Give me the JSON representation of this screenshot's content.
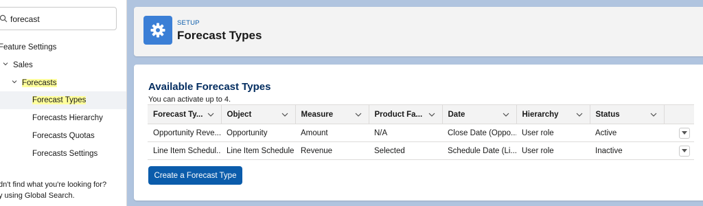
{
  "sidebar": {
    "search": {
      "value": "forecast"
    },
    "items": [
      {
        "label": "Feature Settings"
      },
      {
        "label": "Sales"
      },
      {
        "label": "Forecasts"
      },
      {
        "label": "Forecast Types"
      },
      {
        "label": "Forecasts Hierarchy"
      },
      {
        "label": "Forecasts Quotas"
      },
      {
        "label": "Forecasts Settings"
      }
    ],
    "help_line1": "dn't find what you're looking for?",
    "help_line2": "y using Global Search."
  },
  "header": {
    "eyebrow": "SETUP",
    "title": "Forecast Types",
    "icon": "gear-icon",
    "icon_color": "#3b7fd6"
  },
  "main": {
    "section_title": "Available Forecast Types",
    "section_sub": "You can activate up to 4.",
    "columns": [
      "Forecast Ty...",
      "Object",
      "Measure",
      "Product Fa...",
      "Date",
      "Hierarchy",
      "Status"
    ],
    "rows": [
      [
        "Opportunity Reve...",
        "Opportunity",
        "Amount",
        "N/A",
        "Close Date (Oppo...",
        "User role",
        "Active"
      ],
      [
        "Line Item Schedul...",
        "Line Item Schedule",
        "Revenue",
        "Selected",
        "Schedule Date (Li...",
        "User role",
        "Inactive"
      ]
    ],
    "create_button": "Create a Forecast Type",
    "accent_color": "#0b5cab"
  }
}
